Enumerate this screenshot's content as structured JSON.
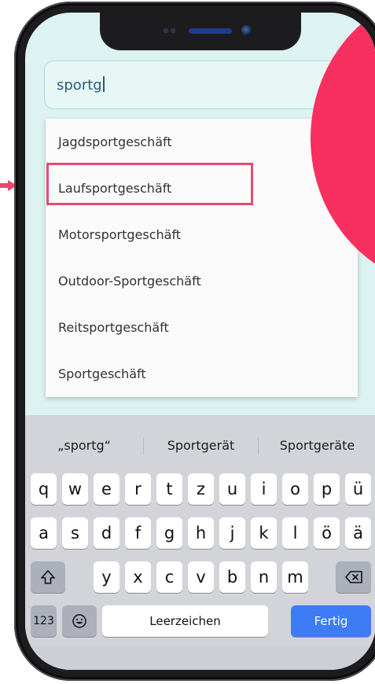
{
  "search": {
    "value": "sportg"
  },
  "dropdown": {
    "items": [
      "Jagdsportgeschäft",
      "Laufsportgeschäft",
      "Motorsportgeschäft",
      "Outdoor-Sportgeschäft",
      "Reitsportgeschäft",
      "Sportgeschäft"
    ],
    "highlighted_index": 1
  },
  "keyboard": {
    "suggestions": [
      "„sportg“",
      "Sportgerät",
      "Sportgeräte"
    ],
    "rows": [
      [
        "q",
        "w",
        "e",
        "r",
        "t",
        "z",
        "u",
        "i",
        "o",
        "p",
        "ü"
      ],
      [
        "a",
        "s",
        "d",
        "f",
        "g",
        "h",
        "j",
        "k",
        "l",
        "ö",
        "ä"
      ],
      [
        "y",
        "x",
        "c",
        "v",
        "b",
        "n",
        "m"
      ]
    ],
    "numbers_label": "123",
    "space_label": "Leerzeichen",
    "done_label": "Fertig",
    "icons": {
      "shift": "shift-icon",
      "backspace": "backspace-icon",
      "emoji": "emoji-icon"
    }
  },
  "colors": {
    "accent_circle": "#f8305f",
    "highlight_border": "#ea4871",
    "done_key": "#3d7cf5",
    "screen_bg": "#ddf3f1"
  }
}
